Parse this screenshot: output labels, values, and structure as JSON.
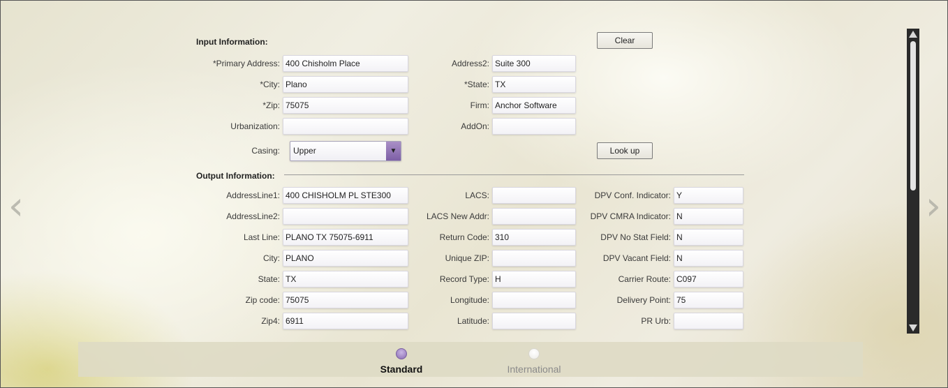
{
  "input": {
    "title": "Input Information:",
    "clear_label": "Clear",
    "lookup_label": "Look up",
    "primary_address_label": "*Primary Address:",
    "primary_address_value": "400 Chisholm Place",
    "address2_label": "Address2:",
    "address2_value": "Suite 300",
    "city_label": "*City:",
    "city_value": "Plano",
    "state_label": "*State:",
    "state_value": "TX",
    "zip_label": "*Zip:",
    "zip_value": "75075",
    "firm_label": "Firm:",
    "firm_value": "Anchor Software",
    "urbanization_label": "Urbanization:",
    "urbanization_value": "",
    "addon_label": "AddOn:",
    "addon_value": "",
    "casing_label": "Casing:",
    "casing_value": "Upper"
  },
  "output": {
    "title": "Output Information:",
    "col1": [
      {
        "label": "AddressLine1:",
        "value": "400 CHISHOLM PL STE300"
      },
      {
        "label": "AddressLine2:",
        "value": ""
      },
      {
        "label": "Last Line:",
        "value": "PLANO TX 75075-6911"
      },
      {
        "label": "City:",
        "value": "PLANO"
      },
      {
        "label": "State:",
        "value": "TX"
      },
      {
        "label": "Zip code:",
        "value": "75075"
      },
      {
        "label": "Zip4:",
        "value": "6911"
      }
    ],
    "col2": [
      {
        "label": "LACS:",
        "value": ""
      },
      {
        "label": "LACS New Addr:",
        "value": ""
      },
      {
        "label": "Return Code:",
        "value": "310"
      },
      {
        "label": "Unique ZIP:",
        "value": ""
      },
      {
        "label": "Record Type:",
        "value": "H"
      },
      {
        "label": "Longitude:",
        "value": ""
      },
      {
        "label": "Latitude:",
        "value": ""
      }
    ],
    "col3": [
      {
        "label": "DPV Conf. Indicator:",
        "value": "Y"
      },
      {
        "label": "DPV CMRA Indicator:",
        "value": "N"
      },
      {
        "label": "DPV No Stat Field:",
        "value": "N"
      },
      {
        "label": "DPV Vacant Field:",
        "value": "N"
      },
      {
        "label": "Carrier Route:",
        "value": "C097"
      },
      {
        "label": "Delivery Point:",
        "value": "75"
      },
      {
        "label": "PR Urb:",
        "value": ""
      }
    ]
  },
  "footer": {
    "tabs": [
      {
        "label": "Standard",
        "active": true
      },
      {
        "label": "International",
        "active": false
      }
    ]
  },
  "icons": {
    "left_nav": "chevron-left-icon",
    "right_nav": "chevron-right-icon",
    "dropdown": "triangle-down-icon"
  },
  "colors": {
    "accent": "#8a6cb3",
    "active_tab_text": "#111111",
    "inactive_tab_text": "#8a8a8a"
  }
}
